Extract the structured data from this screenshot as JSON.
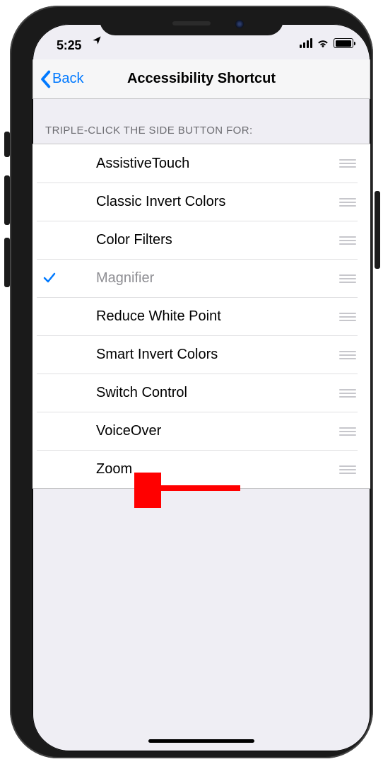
{
  "statusbar": {
    "time": "5:25"
  },
  "navbar": {
    "back_label": "Back",
    "title": "Accessibility Shortcut"
  },
  "section": {
    "header": "TRIPLE-CLICK THE SIDE BUTTON FOR:"
  },
  "items": [
    {
      "label": "AssistiveTouch",
      "selected": false
    },
    {
      "label": "Classic Invert Colors",
      "selected": false
    },
    {
      "label": "Color Filters",
      "selected": false
    },
    {
      "label": "Magnifier",
      "selected": true
    },
    {
      "label": "Reduce White Point",
      "selected": false
    },
    {
      "label": "Smart Invert Colors",
      "selected": false
    },
    {
      "label": "Switch Control",
      "selected": false
    },
    {
      "label": "VoiceOver",
      "selected": false
    },
    {
      "label": "Zoom",
      "selected": false
    }
  ],
  "colors": {
    "accent": "#0079ff",
    "arrow": "#ff0000"
  },
  "annotation": {
    "arrow_target_index": 8
  }
}
